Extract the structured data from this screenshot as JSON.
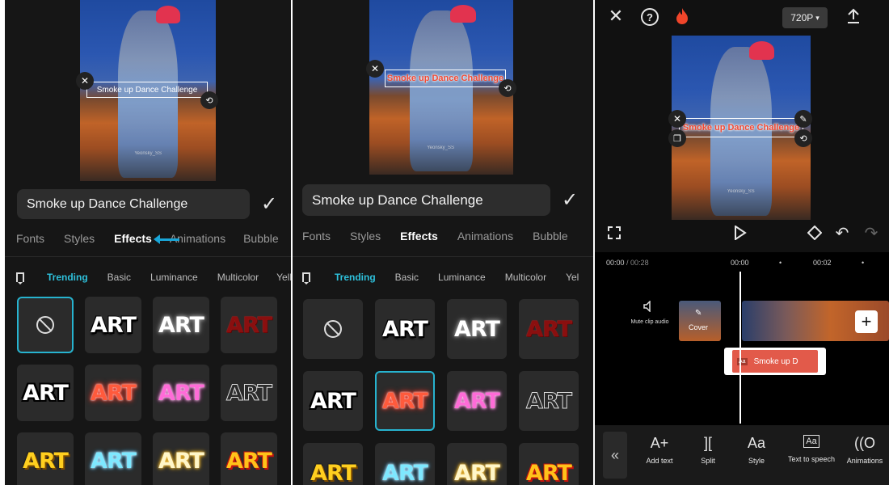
{
  "caption_text": "Smoke up Dance Challenge",
  "watermark": "Yeonsky_SS",
  "panel1": {
    "input_value": "Smoke up Dance Challenge",
    "tabs": [
      "Fonts",
      "Styles",
      "Effects",
      "Animations",
      "Bubble"
    ],
    "active_tab": "Effects",
    "categories": [
      "Trending",
      "Basic",
      "Luminance",
      "Multicolor",
      "Yell"
    ],
    "active_category": "Trending",
    "tile_text": "ART"
  },
  "panel2": {
    "input_value": "Smoke up Dance Challenge",
    "tabs": [
      "Fonts",
      "Styles",
      "Effects",
      "Animations",
      "Bubble"
    ],
    "active_tab": "Effects",
    "categories": [
      "Trending",
      "Basic",
      "Luminance",
      "Multicolor",
      "Yel"
    ],
    "active_category": "Trending",
    "tile_text": "ART"
  },
  "panel3": {
    "resolution": "720P",
    "resolution_caret": "▾",
    "time_current": "00:00",
    "time_total": "/ 00:28",
    "ruler": [
      "00:00",
      "00:02"
    ],
    "mute_label": "Mute clip audio",
    "cover_label": "Cover",
    "text_clip": "Smoke up D",
    "tools": [
      {
        "icon": "A+",
        "label": "Add text"
      },
      {
        "icon": "][",
        "label": "Split"
      },
      {
        "icon": "Aa",
        "label": "Style"
      },
      {
        "icon": "Aa",
        "label": "Text to speech"
      },
      {
        "icon": "((O",
        "label": "Animations"
      }
    ]
  },
  "colors": {
    "accent": "#2ec1dc",
    "background": "#161616",
    "caption_red": "#f24a35"
  },
  "icons": [
    "close-icon",
    "help-icon",
    "fire-icon",
    "upload-icon",
    "fullscreen-icon",
    "play-icon",
    "keyframe-icon",
    "undo-icon",
    "redo-icon",
    "speaker-icon",
    "plus-icon",
    "collapse-icon",
    "check-icon",
    "bookmark-icon",
    "none-icon",
    "rotate-icon",
    "edit-icon",
    "duplicate-icon"
  ]
}
